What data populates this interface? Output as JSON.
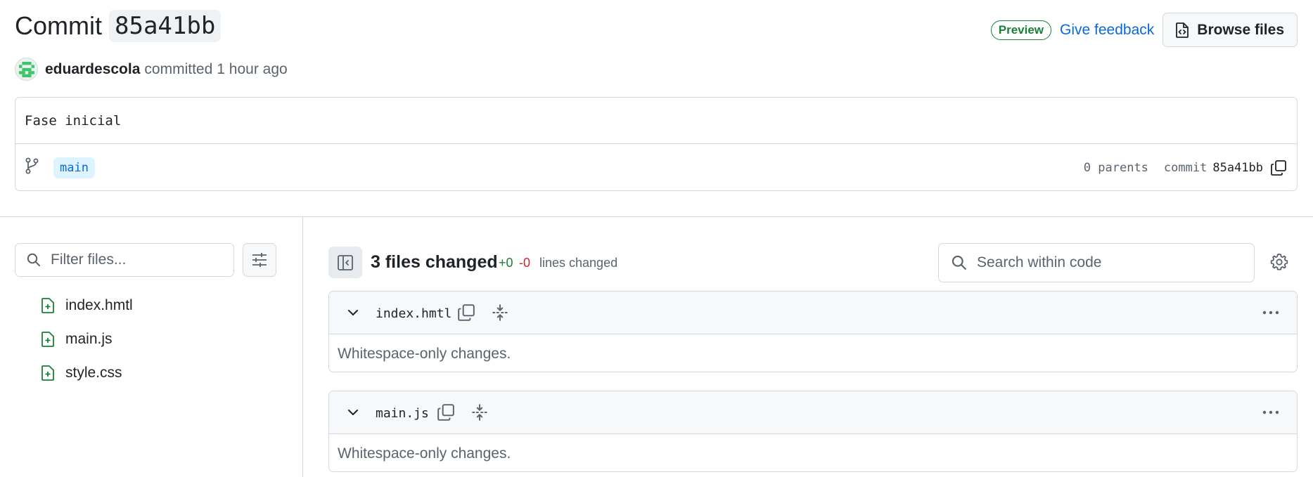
{
  "header": {
    "title_word": "Commit",
    "title_sha": "85a41bb",
    "preview_badge": "Preview",
    "feedback_link": "Give feedback",
    "browse_button": "Browse files"
  },
  "author": {
    "name": "eduardescola",
    "action": "committed",
    "time": "1 hour ago"
  },
  "commit": {
    "message": "Fase inicial",
    "branch": "main",
    "parents": "0 parents",
    "commit_label": "commit",
    "sha": "85a41bb"
  },
  "file_tree": {
    "filter_placeholder": "Filter files...",
    "files": [
      "index.hmtl",
      "main.js",
      "style.css"
    ]
  },
  "diff": {
    "files_changed": "3 files changed",
    "additions": "+0",
    "deletions": "-0",
    "lines_label": "lines changed",
    "search_placeholder": "Search within code",
    "cards": [
      {
        "filename": "index.hmtl",
        "body": "Whitespace-only changes."
      },
      {
        "filename": "main.js",
        "body": "Whitespace-only changes."
      }
    ]
  },
  "icons": {
    "branch": "git-branch-icon",
    "copy": "copy-icon",
    "file_added": "file-added-icon",
    "search": "search-icon",
    "gear": "gear-icon",
    "kebab": "kebab-horizontal-icon",
    "chevron": "chevron-down-icon",
    "expand": "unfold-icon",
    "sidebar": "sidebar-toggle-icon",
    "filter_settings": "sliders-icon",
    "file_code": "file-code-icon"
  },
  "colors": {
    "accent": "#0969da",
    "added": "#1a7f37",
    "deleted": "#d1242f",
    "border": "#d1d9e0",
    "muted": "#59636e"
  }
}
